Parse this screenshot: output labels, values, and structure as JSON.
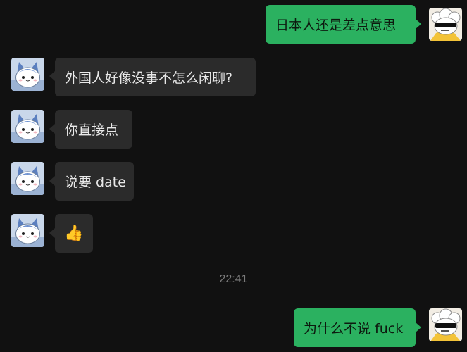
{
  "messages": [
    {
      "from": "me",
      "text": "日本人还是差点意思",
      "avatar": "sunglasses-sheep-avatar"
    },
    {
      "from": "other",
      "text": "外国人好像没事不怎么闲聊?",
      "avatar": "blue-cat-avatar"
    },
    {
      "from": "other",
      "text": "你直接点",
      "avatar": "blue-cat-avatar"
    },
    {
      "from": "other",
      "text": "说要 date",
      "avatar": "blue-cat-avatar"
    },
    {
      "from": "other",
      "text": "👍",
      "avatar": "blue-cat-avatar"
    },
    {
      "from": "me",
      "text": "为什么不说 fuck",
      "avatar": "sunglasses-sheep-avatar"
    }
  ],
  "timestamp": "22:41",
  "colors": {
    "background": "#111111",
    "incoming_bubble": "#2b2b2b",
    "outgoing_bubble": "#2bb160",
    "incoming_text": "#e9e9e9",
    "outgoing_text": "#0d1a0f",
    "timestamp_text": "#7b7b7b"
  }
}
